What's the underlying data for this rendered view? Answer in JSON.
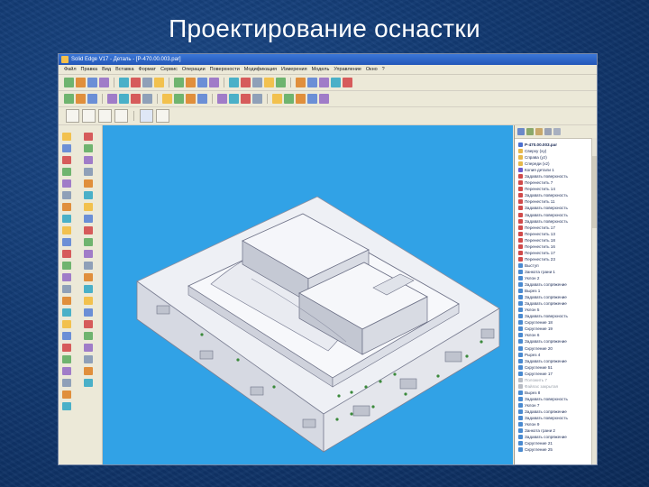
{
  "slide": {
    "title": "Проектирование оснастки"
  },
  "app": {
    "title": "Solid Edge V17 - Деталь - [P-470.00.003.par]",
    "menu": [
      "Файл",
      "Правка",
      "Вид",
      "Вставка",
      "Формат",
      "Сервис",
      "Операции",
      "Поверхности",
      "Модификация",
      "Измерения",
      "Модель",
      "Управление",
      "Окно",
      "?"
    ]
  },
  "tree": {
    "items": [
      {
        "label": "P-470.00.003.par",
        "icon": "part-icon",
        "color": "#4a6fd0",
        "root": true
      },
      {
        "label": "Сверху (xy)",
        "icon": "plane-icon",
        "color": "#e6b84a"
      },
      {
        "label": "Справа (yz)",
        "icon": "plane-icon",
        "color": "#e6b84a"
      },
      {
        "label": "Спереди (xz)",
        "icon": "plane-icon",
        "color": "#e6b84a"
      },
      {
        "label": "Копия детали 1",
        "icon": "copy-part-icon",
        "color": "#6a5acd"
      },
      {
        "label": "Задавать поверхность",
        "icon": "surface-icon",
        "color": "#d04a4a"
      },
      {
        "label": "Перенестить 7",
        "icon": "move-icon",
        "color": "#d04a4a"
      },
      {
        "label": "Перенестить 14",
        "icon": "move-icon",
        "color": "#d04a4a"
      },
      {
        "label": "Задавать поверхность",
        "icon": "surface-icon",
        "color": "#d04a4a"
      },
      {
        "label": "Перенестить 11",
        "icon": "move-icon",
        "color": "#d04a4a"
      },
      {
        "label": "Задавать поверхность",
        "icon": "surface-icon",
        "color": "#d04a4a"
      },
      {
        "label": "Задавать поверхность",
        "icon": "surface-icon",
        "color": "#d04a4a"
      },
      {
        "label": "Задавать поверхность",
        "icon": "surface-icon",
        "color": "#d04a4a"
      },
      {
        "label": "Перенестить 17",
        "icon": "move-icon",
        "color": "#d04a4a"
      },
      {
        "label": "Перенестить 13",
        "icon": "move-icon",
        "color": "#d04a4a"
      },
      {
        "label": "Перенестить 18",
        "icon": "move-icon",
        "color": "#d04a4a"
      },
      {
        "label": "Перенестить 16",
        "icon": "move-icon",
        "color": "#d04a4a"
      },
      {
        "label": "Перенестить 17",
        "icon": "move-icon",
        "color": "#d04a4a"
      },
      {
        "label": "Перенестить 23",
        "icon": "move-icon",
        "color": "#d04a4a"
      },
      {
        "label": "Выступ",
        "icon": "protrusion-icon",
        "color": "#4a8ad0"
      },
      {
        "label": "Занкота грани 1",
        "icon": "face-icon",
        "color": "#4a8ad0"
      },
      {
        "label": "Уклон 2",
        "icon": "draft-icon",
        "color": "#4a8ad0"
      },
      {
        "label": "Задавать сопряжение",
        "icon": "blend-icon",
        "color": "#4a8ad0"
      },
      {
        "label": "Вырез 1",
        "icon": "cutout-icon",
        "color": "#4a8ad0"
      },
      {
        "label": "Задавать сопряжение",
        "icon": "blend-icon",
        "color": "#4a8ad0"
      },
      {
        "label": "Задавать сопряжение",
        "icon": "blend-icon",
        "color": "#4a8ad0"
      },
      {
        "label": "Уклон 5",
        "icon": "draft-icon",
        "color": "#4a8ad0"
      },
      {
        "label": "Задавать поверхность",
        "icon": "surface-icon",
        "color": "#4a8ad0"
      },
      {
        "label": "Скругление 18",
        "icon": "round-icon",
        "color": "#4a8ad0"
      },
      {
        "label": "Скругление 19",
        "icon": "round-icon",
        "color": "#4a8ad0"
      },
      {
        "label": "Уклон 6",
        "icon": "draft-icon",
        "color": "#4a8ad0"
      },
      {
        "label": "Задавать сопряжение",
        "icon": "blend-icon",
        "color": "#4a8ad0"
      },
      {
        "label": "Скругление 20",
        "icon": "round-icon",
        "color": "#4a8ad0"
      },
      {
        "label": "Рырез 4",
        "icon": "cutout-icon",
        "color": "#4a8ad0"
      },
      {
        "label": "Задавать сопряжение",
        "icon": "blend-icon",
        "color": "#4a8ad0"
      },
      {
        "label": "Скругление 51",
        "icon": "round-icon",
        "color": "#4a8ad0"
      },
      {
        "label": "Скругление 17",
        "icon": "round-icon",
        "color": "#4a8ad0"
      },
      {
        "label": "Положить 7",
        "icon": "move-icon",
        "color": "#b8bcc4",
        "dim": true
      },
      {
        "label": "Файлас закрытая",
        "icon": "surface-icon",
        "color": "#b8bcc4",
        "dim": true
      },
      {
        "label": "Вырез 8",
        "icon": "cutout-icon",
        "color": "#4a8ad0"
      },
      {
        "label": "Задавать поверхность",
        "icon": "surface-icon",
        "color": "#4a8ad0"
      },
      {
        "label": "Уклон 7",
        "icon": "draft-icon",
        "color": "#4a8ad0"
      },
      {
        "label": "Задавать сопряжение",
        "icon": "blend-icon",
        "color": "#4a8ad0"
      },
      {
        "label": "Задавать поверхность",
        "icon": "surface-icon",
        "color": "#4a8ad0"
      },
      {
        "label": "Уклон 9",
        "icon": "draft-icon",
        "color": "#4a8ad0"
      },
      {
        "label": "Занкота грани 2",
        "icon": "face-icon",
        "color": "#4a8ad0"
      },
      {
        "label": "Задавать сопряжение",
        "icon": "blend-icon",
        "color": "#4a8ad0"
      },
      {
        "label": "Скругление 21",
        "icon": "round-icon",
        "color": "#4a8ad0"
      },
      {
        "label": "Скругление 25",
        "icon": "round-icon",
        "color": "#4a8ad0"
      }
    ]
  },
  "colors": {
    "viewport_bg": "#31a2e6",
    "model_face": "#f3f4f8",
    "model_shade": "#c9ccd6",
    "hole_green": "#3b8a3b"
  }
}
